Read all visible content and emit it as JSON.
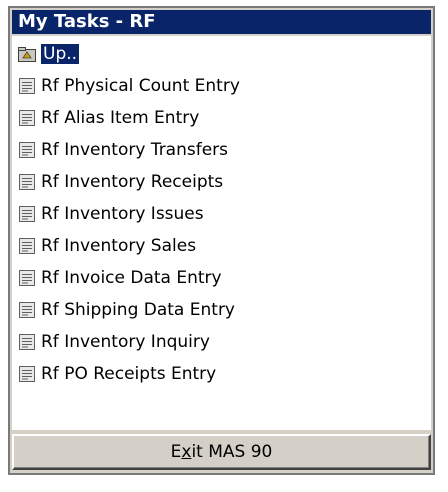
{
  "window": {
    "title": "My Tasks - RF"
  },
  "tasks": {
    "items": [
      {
        "label": "Up..",
        "icon": "folder-up-icon",
        "selected": true
      },
      {
        "label": "Rf Physical Count Entry",
        "icon": "task-document-icon"
      },
      {
        "label": "Rf Alias Item Entry",
        "icon": "task-document-icon"
      },
      {
        "label": "Rf Inventory Transfers",
        "icon": "task-document-icon"
      },
      {
        "label": "Rf Inventory Receipts",
        "icon": "task-document-icon"
      },
      {
        "label": "Rf Inventory Issues",
        "icon": "task-document-icon"
      },
      {
        "label": "Rf Inventory Sales",
        "icon": "task-document-icon"
      },
      {
        "label": "Rf Invoice Data Entry",
        "icon": "task-document-icon"
      },
      {
        "label": "Rf Shipping Data Entry",
        "icon": "task-document-icon"
      },
      {
        "label": "Rf Inventory Inquiry",
        "icon": "task-document-icon"
      },
      {
        "label": "Rf PO Receipts Entry",
        "icon": "task-document-icon"
      }
    ]
  },
  "exit_button": {
    "label_pre": "E",
    "label_accel": "x",
    "label_post": "it MAS 90"
  },
  "colors": {
    "title_bar": "#0a246a",
    "selection": "#0a246a",
    "button_face": "#d4d0c8"
  }
}
